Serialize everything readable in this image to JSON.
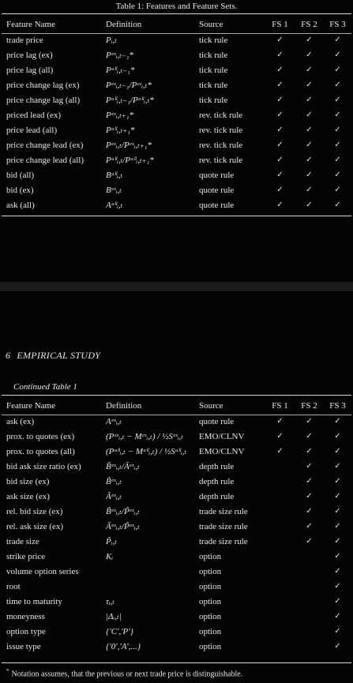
{
  "table1": {
    "caption": "Table 1: Features and Feature Sets.",
    "headers": [
      "Feature Name",
      "Definition",
      "Source",
      "FS 1",
      "FS 2",
      "FS 3"
    ],
    "rows": [
      {
        "name": "trade price",
        "def": "Pᵢ,ₜ",
        "source": "tick rule",
        "fs1": "✓",
        "fs2": "✓",
        "fs3": "✓"
      },
      {
        "name": "price lag (ex)",
        "def": "Pᵉˣᵢ,ₜ₋₁*",
        "source": "tick rule",
        "fs1": "✓",
        "fs2": "✓",
        "fs3": "✓"
      },
      {
        "name": "price lag (all)",
        "def": "Pᵃˡˡᵢ,ₜ₋₁*",
        "source": "tick rule",
        "fs1": "✓",
        "fs2": "✓",
        "fs3": "✓"
      },
      {
        "name": "price change lag (ex)",
        "def": "Pᵉˣᵢ,ₜ₋₁/Pᵉˣᵢ,ₜ*",
        "source": "tick rule",
        "fs1": "✓",
        "fs2": "✓",
        "fs3": "✓"
      },
      {
        "name": "price change lag (all)",
        "def": "Pᵃˡˡᵢ,ₜ₋₁/Pᵃˡˡᵢ,ₜ*",
        "source": "tick rule",
        "fs1": "✓",
        "fs2": "✓",
        "fs3": "✓"
      },
      {
        "name": "priced lead (ex)",
        "def": "Pᵉˣᵢ,ₜ₊₁*",
        "source": "rev. tick rule",
        "fs1": "✓",
        "fs2": "✓",
        "fs3": "✓"
      },
      {
        "name": "price lead (all)",
        "def": "Pᵃˡˡᵢ,ₜ₊₁*",
        "source": "rev. tick rule",
        "fs1": "✓",
        "fs2": "✓",
        "fs3": "✓"
      },
      {
        "name": "price change lead (ex)",
        "def": "Pᵉˣᵢ,ₜ/Pᵉˣᵢ,ₜ₊₁*",
        "source": "rev. tick rule",
        "fs1": "✓",
        "fs2": "✓",
        "fs3": "✓"
      },
      {
        "name": "price change lead (all)",
        "def": "Pᵃˡˡᵢ,ₜ/Pᵃˡˡᵢ,ₜ₊₁*",
        "source": "rev. tick rule",
        "fs1": "✓",
        "fs2": "✓",
        "fs3": "✓"
      },
      {
        "name": "bid (all)",
        "def": "Bᵃˡˡᵢ,ₜ",
        "source": "quote rule",
        "fs1": "✓",
        "fs2": "✓",
        "fs3": "✓"
      },
      {
        "name": "bid (ex)",
        "def": "Bᵉˣᵢ,ₜ",
        "source": "quote rule",
        "fs1": "✓",
        "fs2": "✓",
        "fs3": "✓"
      },
      {
        "name": "ask (all)",
        "def": "Aᵃˡˡᵢ,ₜ",
        "source": "quote rule",
        "fs1": "✓",
        "fs2": "✓",
        "fs3": "✓"
      }
    ]
  },
  "section": {
    "number": "6",
    "title": "EMPIRICAL STUDY"
  },
  "table1_cont": {
    "caption": "Continued Table 1",
    "headers": [
      "Feature Name",
      "Definition",
      "Source",
      "FS 1",
      "FS 2",
      "FS 3"
    ],
    "rows": [
      {
        "name": "ask (ex)",
        "def": "Aᵉˣᵢ,ₜ",
        "source": "quote rule",
        "fs1": "✓",
        "fs2": "✓",
        "fs3": "✓"
      },
      {
        "name": "prox. to quotes (ex)",
        "def": "(Pᵉˣᵢ,ₜ − Mᵉˣᵢ,ₜ) / ½Sᵉˣᵢ,ₜ",
        "source": "EMO/CLNV",
        "fs1": "✓",
        "fs2": "✓",
        "fs3": "✓"
      },
      {
        "name": "prox. to quotes (all)",
        "def": "(Pᵃˡˡᵢ,ₜ − Mᵃˡˡᵢ,ₜ) / ½Sᵃˡˡᵢ,ₜ",
        "source": "EMO/CLNV",
        "fs1": "✓",
        "fs2": "✓",
        "fs3": "✓"
      },
      {
        "name": "bid ask size ratio (ex)",
        "def": "B̃ᵉˣᵢ,ₜ/Ãᵉˣᵢ,ₜ",
        "source": "depth rule",
        "fs1": "",
        "fs2": "✓",
        "fs3": "✓"
      },
      {
        "name": "bid size (ex)",
        "def": "B̃ᵉˣᵢ,ₜ",
        "source": "depth rule",
        "fs1": "",
        "fs2": "✓",
        "fs3": "✓"
      },
      {
        "name": "ask size (ex)",
        "def": "Ãᵉˣᵢ,ₜ",
        "source": "depth rule",
        "fs1": "",
        "fs2": "✓",
        "fs3": "✓"
      },
      {
        "name": "rel. bid size (ex)",
        "def": "B̃ᵉˣᵢ,ₜ/P̃ᵉˣᵢ,ₜ",
        "source": "trade size rule",
        "fs1": "",
        "fs2": "✓",
        "fs3": "✓"
      },
      {
        "name": "rel. ask size (ex)",
        "def": "Ãᵉˣᵢ,ₜ/P̃ᵉˣᵢ,ₜ",
        "source": "trade size rule",
        "fs1": "",
        "fs2": "✓",
        "fs3": "✓"
      },
      {
        "name": "trade size",
        "def": "P̃ᵢ,ₜ",
        "source": "trade size rule",
        "fs1": "",
        "fs2": "✓",
        "fs3": "✓"
      },
      {
        "name": "strike price",
        "def": "Kᵢ",
        "source": "option",
        "fs1": "",
        "fs2": "",
        "fs3": "✓"
      },
      {
        "name": "volume option series",
        "def": "",
        "source": "option",
        "fs1": "",
        "fs2": "",
        "fs3": "✓"
      },
      {
        "name": "root",
        "def": "",
        "source": "option",
        "fs1": "",
        "fs2": "",
        "fs3": "✓"
      },
      {
        "name": "time to maturity",
        "def": "τᵢ,ₜ",
        "source": "option",
        "fs1": "",
        "fs2": "",
        "fs3": "✓"
      },
      {
        "name": "moneyness",
        "def": "|Δᵢ,ₜ|",
        "source": "option",
        "fs1": "",
        "fs2": "",
        "fs3": "✓"
      },
      {
        "name": "option type",
        "def": "{'C','P'}",
        "source": "option",
        "fs1": "",
        "fs2": "",
        "fs3": "✓"
      },
      {
        "name": "issue type",
        "def": "{'0','A',...}",
        "source": "option",
        "fs1": "",
        "fs2": "",
        "fs3": "✓"
      }
    ]
  },
  "footnote": {
    "marker": "*",
    "text": "Notation assumes, that the previous or next trade price is distinguishable."
  }
}
